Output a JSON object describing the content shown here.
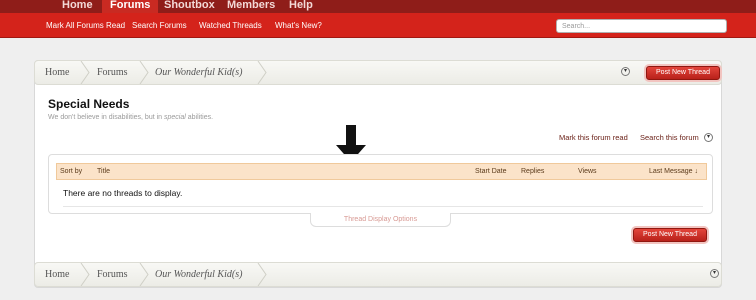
{
  "topnav": {
    "tabs": [
      {
        "label": "Home"
      },
      {
        "label": "Forums"
      },
      {
        "label": "Shoutbox"
      },
      {
        "label": "Members"
      },
      {
        "label": "Help"
      }
    ]
  },
  "subnav": {
    "links": [
      {
        "label": "Mark All Forums Read"
      },
      {
        "label": "Search Forums"
      },
      {
        "label": "Watched Threads"
      },
      {
        "label": "What's New?"
      }
    ],
    "search_placeholder": "Search..."
  },
  "breadcrumb": {
    "items": [
      {
        "label": "Home"
      },
      {
        "label": "Forums"
      },
      {
        "label": "Our Wonderful Kid(s)"
      }
    ]
  },
  "post_button_label": "Post New Thread",
  "forum": {
    "title": "Special Needs",
    "desc_before": "We don't believe in disabilities, but in ",
    "desc_em": "special",
    "desc_after": " abilities."
  },
  "actions": {
    "mark_read": "Mark this forum read",
    "search_forum": "Search this forum"
  },
  "list": {
    "columns": {
      "sort_by": "Sort by",
      "title": "Title",
      "start_date": "Start Date",
      "replies": "Replies",
      "views": "Views",
      "last_message": "Last Message ↓"
    },
    "empty_message": "There are no threads to display.",
    "display_options": "Thread Display Options"
  }
}
